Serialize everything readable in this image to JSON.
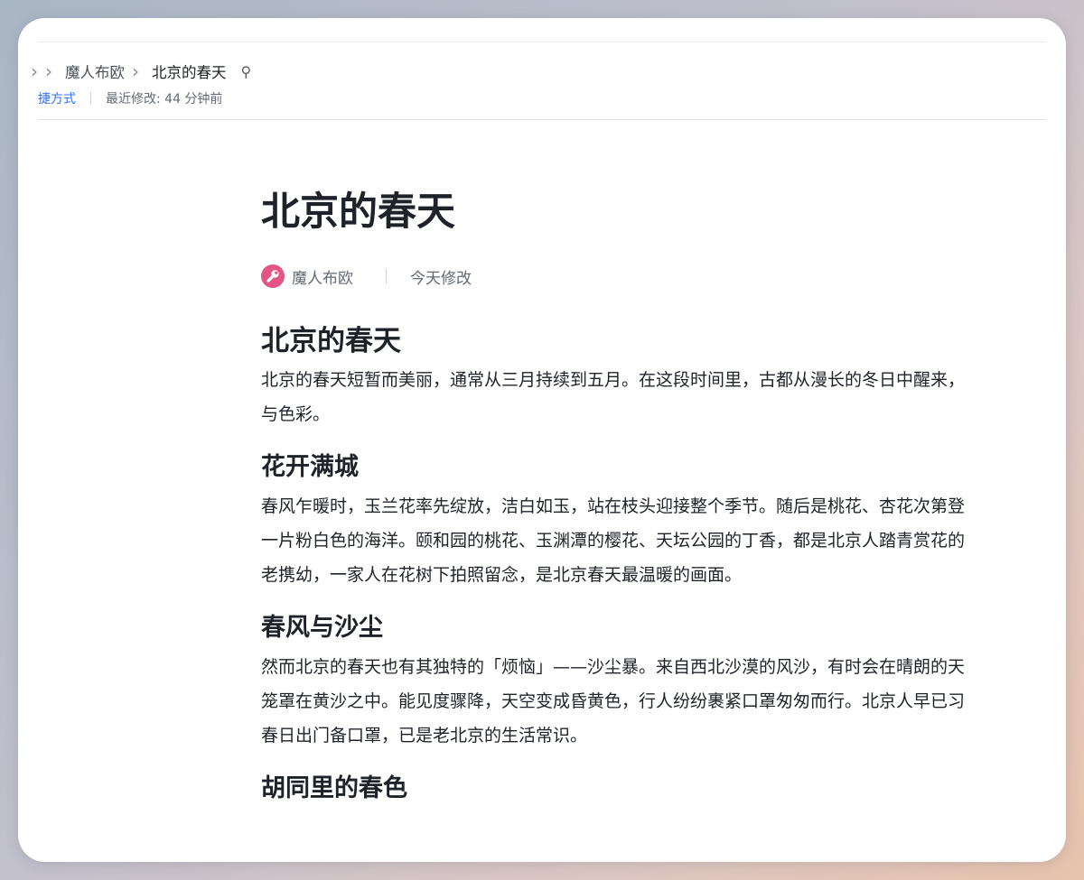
{
  "breadcrumb": {
    "items": [
      "魔人布欧",
      "北京的春天"
    ],
    "separator_icon": "chevron-right-icon",
    "pin_icon": "pin-icon"
  },
  "header": {
    "shortcut_link": "捷方式",
    "last_modified": "最近修改: 44 分钟前"
  },
  "doc": {
    "title": "北京的春天",
    "author": "魔人布欧",
    "edited": "今天修改",
    "sections": [
      {
        "heading": "北京的春天",
        "lines": [
          "北京的春天短暂而美丽，通常从三月持续到五月。在这段时间里，古都从漫长的冬日中醒来，",
          "与色彩。"
        ]
      },
      {
        "heading": "花开满城",
        "lines": [
          "春风乍暖时，玉兰花率先绽放，洁白如玉，站在枝头迎接整个季节。随后是桃花、杏花次第登",
          "一片粉白色的海洋。颐和园的桃花、玉渊潭的樱花、天坛公园的丁香，都是北京人踏青赏花的",
          "老携幼，一家人在花树下拍照留念，是北京春天最温暖的画面。"
        ]
      },
      {
        "heading": "春风与沙尘",
        "lines": [
          "然而北京的春天也有其独特的「烦恼」——沙尘暴。来自西北沙漠的风沙，有时会在晴朗的天",
          "笼罩在黄沙之中。能见度骤降，天空变成昏黄色，行人纷纷裹紧口罩匆匆而行。北京人早已习",
          "春日出门备口罩，已是老北京的生活常识。"
        ]
      },
      {
        "heading": "胡同里的春色",
        "lines": []
      }
    ]
  },
  "colors": {
    "link": "#3370ff",
    "avatar": "#e35583",
    "text": "#1f2329",
    "muted": "#646a73"
  }
}
